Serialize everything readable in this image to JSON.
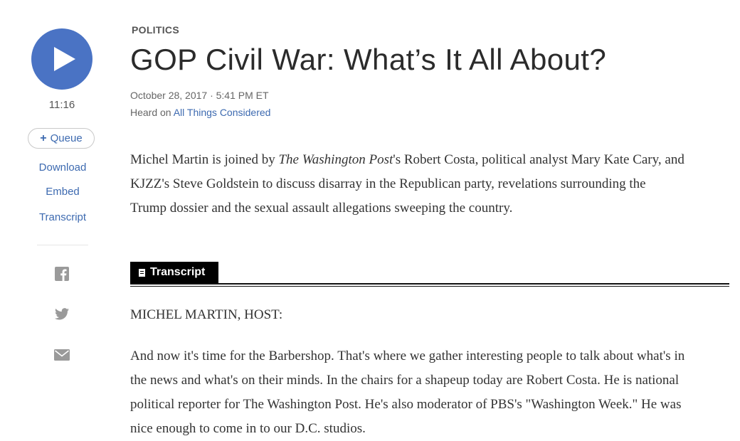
{
  "player": {
    "duration": "11:16",
    "queue_label": "Queue"
  },
  "rail_links": {
    "download": "Download",
    "embed": "Embed",
    "transcript": "Transcript"
  },
  "share_icons": [
    "facebook-icon",
    "twitter-icon",
    "email-icon"
  ],
  "story": {
    "section": "POLITICS",
    "title": "GOP Civil War: What’s It All About?",
    "dateline": "October 28, 2017 · 5:41 PM ET",
    "heard_prefix": "Heard on ",
    "program": "All Things Considered",
    "teaser": {
      "part1": "Michel Martin is joined by ",
      "publication": "The Washington Post",
      "part2": "'s Robert Costa, political analyst Mary Kate Cary, and KJZZ's Steve Goldstein to discuss disarray in the Republican party, revelations surrounding the Trump dossier and the sexual assault allegations sweeping the country."
    }
  },
  "transcript": {
    "tab_label": "Transcript",
    "speaker": "MICHEL MARTIN, HOST:",
    "paragraph": "And now it's time for the Barbershop. That's where we gather interesting people to talk about what's in the news and what's on their minds. In the chairs for a shapeup today are Robert Costa. He is national political reporter for The Washington Post. He's also moderator of PBS's \"Washington Week.\" He was nice enough to come in to our D.C. studios."
  },
  "colors": {
    "accent": "#4a73c4",
    "link": "#3d6ab0",
    "tab_bg": "#000000"
  }
}
